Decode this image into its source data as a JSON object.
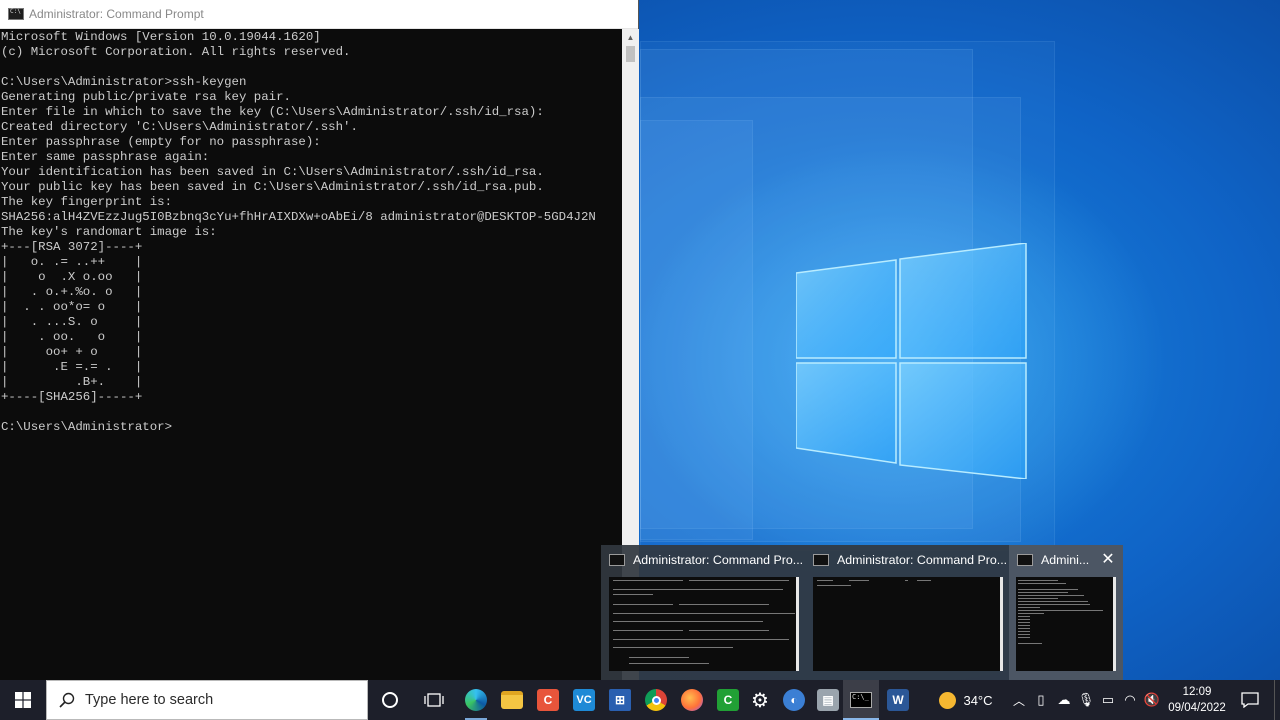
{
  "window": {
    "title": "Administrator: Command Prompt",
    "console_lines": [
      "Microsoft Windows [Version 10.0.19044.1620]",
      "(c) Microsoft Corporation. All rights reserved.",
      "",
      "C:\\Users\\Administrator>ssh-keygen",
      "Generating public/private rsa key pair.",
      "Enter file in which to save the key (C:\\Users\\Administrator/.ssh/id_rsa):",
      "Created directory 'C:\\Users\\Administrator/.ssh'.",
      "Enter passphrase (empty for no passphrase):",
      "Enter same passphrase again:",
      "Your identification has been saved in C:\\Users\\Administrator/.ssh/id_rsa.",
      "Your public key has been saved in C:\\Users\\Administrator/.ssh/id_rsa.pub.",
      "The key fingerprint is:",
      "SHA256:alH4ZVEzzJug5I0Bzbnq3cYu+fhHrAIXDXw+oAbEi/8 administrator@DESKTOP-5GD4J2N",
      "The key's randomart image is:",
      "+---[RSA 3072]----+",
      "|   o. .= ..++    |",
      "|    o  .X o.oo   |",
      "|   . o.+.%o. o   |",
      "|  . . oo*o= o    |",
      "|   . ...S. o     |",
      "|    . oo.   o    |",
      "|     oo+ + o     |",
      "|      .E =.= .   |",
      "|         .B+.    |",
      "+----[SHA256]-----+",
      "",
      "C:\\Users\\Administrator>"
    ]
  },
  "thumbnails": [
    {
      "title": "Administrator: Command Pro..."
    },
    {
      "title": "Administrator: Command Pro..."
    },
    {
      "title": "Admini...",
      "close": "✕"
    }
  ],
  "taskbar": {
    "search_placeholder": "Type here to search",
    "apps": [
      {
        "name": "task-view",
        "icon": "task-view-icon"
      },
      {
        "name": "edge",
        "icon": "edge-icon"
      },
      {
        "name": "file-explorer",
        "icon": "folder-icon"
      },
      {
        "name": "app-red",
        "icon": "red-app-icon"
      },
      {
        "name": "visual-studio-code",
        "icon": "vscode-icon"
      },
      {
        "name": "app-network",
        "icon": "network-app-icon"
      },
      {
        "name": "chrome",
        "icon": "chrome-icon"
      },
      {
        "name": "firefox",
        "icon": "firefox-icon"
      },
      {
        "name": "app-green",
        "icon": "green-app-icon"
      },
      {
        "name": "settings",
        "icon": "gear-icon"
      },
      {
        "name": "app-blue-circle",
        "icon": "blue-circle-app-icon"
      },
      {
        "name": "app-gray",
        "icon": "gray-app-icon"
      },
      {
        "name": "command-prompt",
        "icon": "cmd-icon"
      },
      {
        "name": "word",
        "icon": "word-icon"
      }
    ],
    "weather": {
      "temperature": "34°C"
    },
    "clock": {
      "time": "12:09",
      "date": "09/04/2022"
    }
  },
  "colors": {
    "console_bg": "#0c0c0c",
    "console_text": "#cccccc",
    "taskbar_bg": "#1d1f2a",
    "wallpaper_blue": "#0f63c6"
  }
}
